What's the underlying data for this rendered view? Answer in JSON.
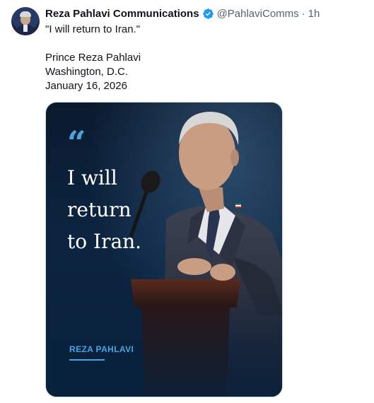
{
  "tweet": {
    "display_name": "Reza Pahlavi Communications",
    "handle": "@PahlaviComms",
    "separator": "·",
    "time": "1h",
    "verified": true,
    "text_lines": [
      "\"I will return to Iran.\""
    ],
    "signature_lines": [
      "Prince Reza Pahlavi",
      "Washington, D.C.",
      "January 16, 2026"
    ]
  },
  "media": {
    "quote_mark": "“",
    "quote_lines": [
      "I will",
      "return",
      "to Iran."
    ],
    "signature": "REZA PAHLAVI"
  },
  "colors": {
    "accent_blue": "#4ba3e0",
    "verified_blue": "#1d9bf0",
    "muted_text": "#536471"
  },
  "icons": {
    "verified": "verified-badge-icon"
  }
}
